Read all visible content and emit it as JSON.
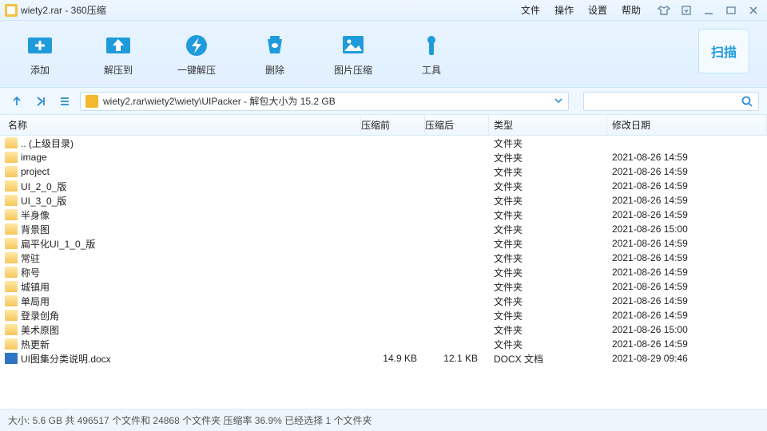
{
  "title": "wiety2.rar - 360压缩",
  "menus": [
    "文件",
    "操作",
    "设置",
    "帮助"
  ],
  "toolbar": [
    {
      "k": "add",
      "label": "添加",
      "color": "#1f9bdc",
      "svg": "plus"
    },
    {
      "k": "extract",
      "label": "解压到",
      "color": "#1f9bdc",
      "svg": "up"
    },
    {
      "k": "oneclick",
      "label": "一键解压",
      "color": "#1f9bdc",
      "svg": "bolt"
    },
    {
      "k": "delete",
      "label": "删除",
      "color": "#1f9bdc",
      "svg": "trash"
    },
    {
      "k": "imgzip",
      "label": "图片压缩",
      "color": "#1f9bdc",
      "svg": "img"
    },
    {
      "k": "tools",
      "label": "工具",
      "color": "#1f9bdc",
      "svg": "tool"
    }
  ],
  "scan_label": "扫描",
  "path_text": "wiety2.rar\\wiety2\\wiety\\UIPacker - 解包大小为 15.2 GB",
  "columns": {
    "name": "名称",
    "before": "压缩前",
    "after": "压缩后",
    "type": "类型",
    "date": "修改日期"
  },
  "rows": [
    {
      "icon": "folder",
      "name": ".. (上级目录)",
      "before": "",
      "after": "",
      "type": "文件夹",
      "date": ""
    },
    {
      "icon": "folder",
      "name": "image",
      "before": "",
      "after": "",
      "type": "文件夹",
      "date": "2021-08-26 14:59"
    },
    {
      "icon": "folder",
      "name": "project",
      "before": "",
      "after": "",
      "type": "文件夹",
      "date": "2021-08-26 14:59"
    },
    {
      "icon": "folder",
      "name": "UI_2_0_版",
      "before": "",
      "after": "",
      "type": "文件夹",
      "date": "2021-08-26 14:59"
    },
    {
      "icon": "folder",
      "name": "UI_3_0_版",
      "before": "",
      "after": "",
      "type": "文件夹",
      "date": "2021-08-26 14:59"
    },
    {
      "icon": "folder",
      "name": "半身像",
      "before": "",
      "after": "",
      "type": "文件夹",
      "date": "2021-08-26 14:59"
    },
    {
      "icon": "folder",
      "name": "背景图",
      "before": "",
      "after": "",
      "type": "文件夹",
      "date": "2021-08-26 15:00"
    },
    {
      "icon": "folder",
      "name": "扁平化UI_1_0_版",
      "before": "",
      "after": "",
      "type": "文件夹",
      "date": "2021-08-26 14:59"
    },
    {
      "icon": "folder",
      "name": "常驻",
      "before": "",
      "after": "",
      "type": "文件夹",
      "date": "2021-08-26 14:59"
    },
    {
      "icon": "folder",
      "name": "称号",
      "before": "",
      "after": "",
      "type": "文件夹",
      "date": "2021-08-26 14:59"
    },
    {
      "icon": "folder",
      "name": "城镇用",
      "before": "",
      "after": "",
      "type": "文件夹",
      "date": "2021-08-26 14:59"
    },
    {
      "icon": "folder",
      "name": "单局用",
      "before": "",
      "after": "",
      "type": "文件夹",
      "date": "2021-08-26 14:59"
    },
    {
      "icon": "folder",
      "name": "登录创角",
      "before": "",
      "after": "",
      "type": "文件夹",
      "date": "2021-08-26 14:59"
    },
    {
      "icon": "folder",
      "name": "美术原图",
      "before": "",
      "after": "",
      "type": "文件夹",
      "date": "2021-08-26 15:00"
    },
    {
      "icon": "folder",
      "name": "热更新",
      "before": "",
      "after": "",
      "type": "文件夹",
      "date": "2021-08-26 14:59"
    },
    {
      "icon": "docx",
      "name": "UI图集分类说明.docx",
      "before": "14.9 KB",
      "after": "12.1 KB",
      "type": "DOCX 文档",
      "date": "2021-08-29 09:46"
    }
  ],
  "status": "大小: 5.6 GB 共 496517 个文件和 24868 个文件夹 压缩率 36.9% 已经选择 1 个文件夹"
}
